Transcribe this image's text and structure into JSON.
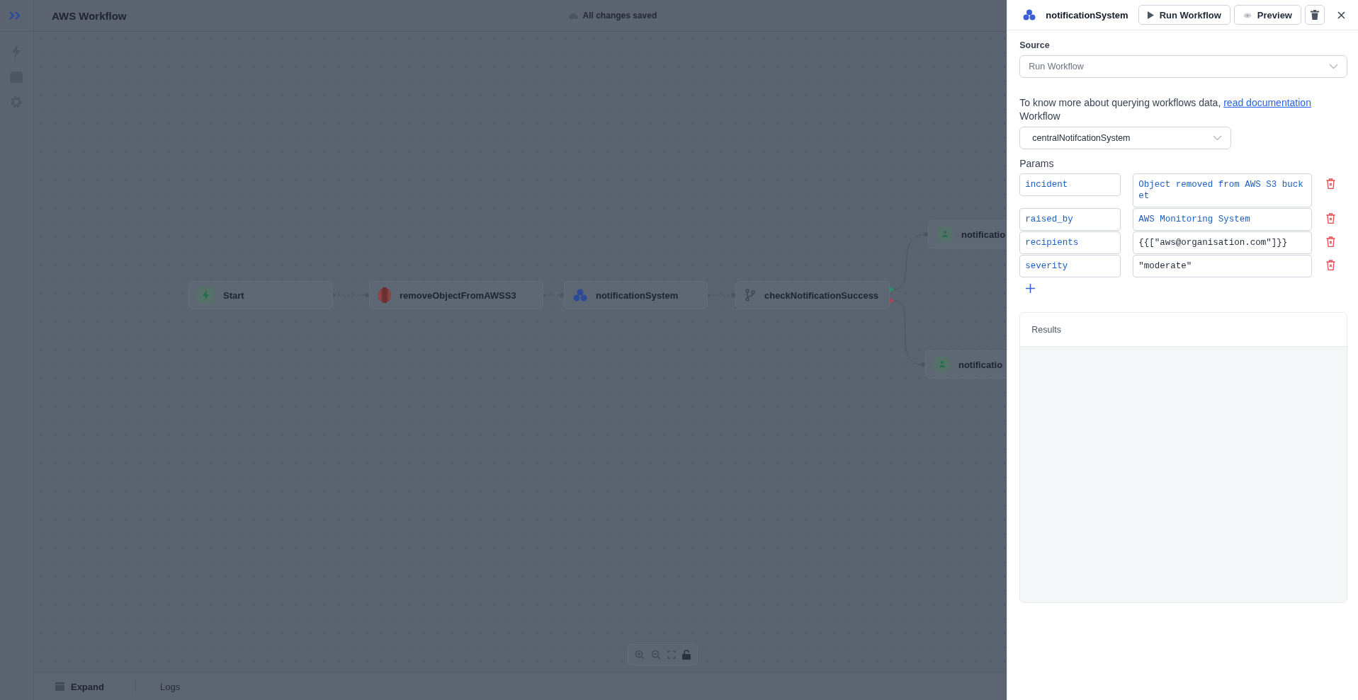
{
  "header": {
    "title": "AWS Workflow",
    "save_status": "All changes saved"
  },
  "canvas": {
    "nodes": [
      {
        "label": "Start",
        "kind": "start"
      },
      {
        "label": "removeObjectFromAWSS3",
        "kind": "s3"
      },
      {
        "label": "notificationSystem",
        "kind": "workflow"
      },
      {
        "label": "checkNotificationSuccess",
        "kind": "condition"
      },
      {
        "label": "notificatio",
        "kind": "notify"
      },
      {
        "label": "notificatio",
        "kind": "notify"
      }
    ]
  },
  "bottom_bar": {
    "items": [
      {
        "label": "Expand",
        "kind": "expand"
      },
      {
        "label": "Logs",
        "kind": "logs"
      }
    ]
  },
  "panel": {
    "title": "notificationSystem",
    "buttons": [
      {
        "label": "Run Workflow",
        "kind": "run"
      },
      {
        "label": "Preview",
        "kind": "preview"
      }
    ],
    "source": {
      "label": "Source",
      "value": "Run Workflow"
    },
    "info": {
      "text": "To know more about querying workflows data,",
      "link": "read documentation"
    },
    "workflow": {
      "label": "Workflow",
      "value": "centralNotifcationSystem"
    },
    "params": {
      "label": "Params",
      "rows": [
        {
          "key": "incident",
          "value": "Object removed from AWS S3 bucket",
          "kind": "string"
        },
        {
          "key": "raised_by",
          "value": "AWS Monitoring System",
          "kind": "string"
        },
        {
          "key": "recipients",
          "value": "{{[\"aws@organisation.com\"]}}",
          "kind": "expression"
        },
        {
          "key": "severity",
          "value": "\"moderate\"",
          "kind": "expression"
        }
      ]
    },
    "results": {
      "title": "Results"
    }
  }
}
